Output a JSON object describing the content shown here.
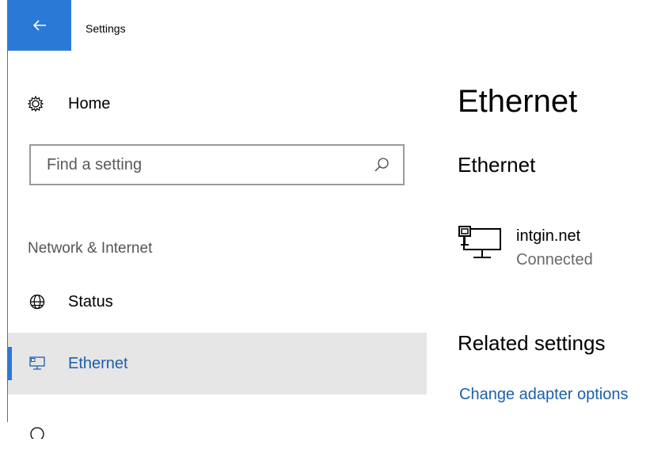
{
  "window": {
    "title": "Settings"
  },
  "nav": {
    "back_icon": "arrow-left-icon",
    "home": {
      "label": "Home",
      "icon": "gear-icon"
    },
    "search": {
      "placeholder": "Find a setting",
      "value": "",
      "icon": "search-icon"
    },
    "section_header": "Network & Internet",
    "items": [
      {
        "label": "Status",
        "icon": "globe-icon",
        "selected": false
      },
      {
        "label": "Ethernet",
        "icon": "ethernet-icon",
        "selected": true
      },
      {
        "label": "",
        "icon": "partial-icon",
        "selected": false
      }
    ]
  },
  "content": {
    "page_title": "Ethernet",
    "section_title": "Ethernet",
    "network": {
      "name": "intgin.net",
      "status": "Connected",
      "icon": "network-computer-icon"
    },
    "related_title": "Related settings",
    "related_link": "Change adapter options"
  },
  "colors": {
    "accent": "#2b79d6",
    "link": "#1d5fab",
    "selected_bg": "#e6e6e6"
  }
}
